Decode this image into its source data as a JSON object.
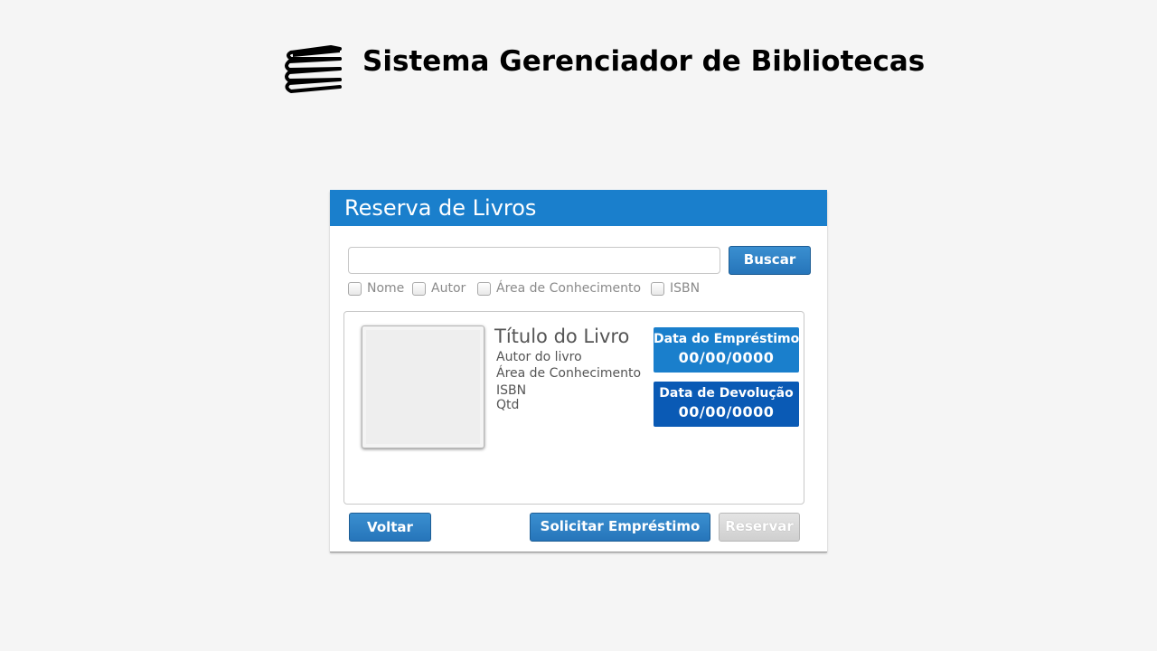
{
  "app": {
    "title": "Sistema Gerenciador de Bibliotecas",
    "logo_icon": "books-stack-icon"
  },
  "panel": {
    "title": "Reserva de Livros",
    "header_color": "#1a7fcc"
  },
  "search": {
    "value": "",
    "placeholder": "",
    "button_label": "Buscar",
    "filters": [
      {
        "label": "Nome",
        "checked": false
      },
      {
        "label": "Autor",
        "checked": false
      },
      {
        "label": "Área de Conhecimento",
        "checked": false
      },
      {
        "label": "ISBN",
        "checked": false
      }
    ]
  },
  "book": {
    "title": "Título do Livro",
    "author": "Autor do livro",
    "area": "Área de Conhecimento",
    "isbn": "ISBN",
    "qty": "Qtd",
    "loan_date_label": "Data do Empréstimo",
    "loan_date_value": "00/00/0000",
    "return_date_label": "Data de Devolução",
    "return_date_value": "00/00/0000"
  },
  "actions": {
    "back_label": "Voltar",
    "request_loan_label": "Solicitar Empréstimo",
    "reserve_label": "Reservar",
    "reserve_disabled": true
  }
}
